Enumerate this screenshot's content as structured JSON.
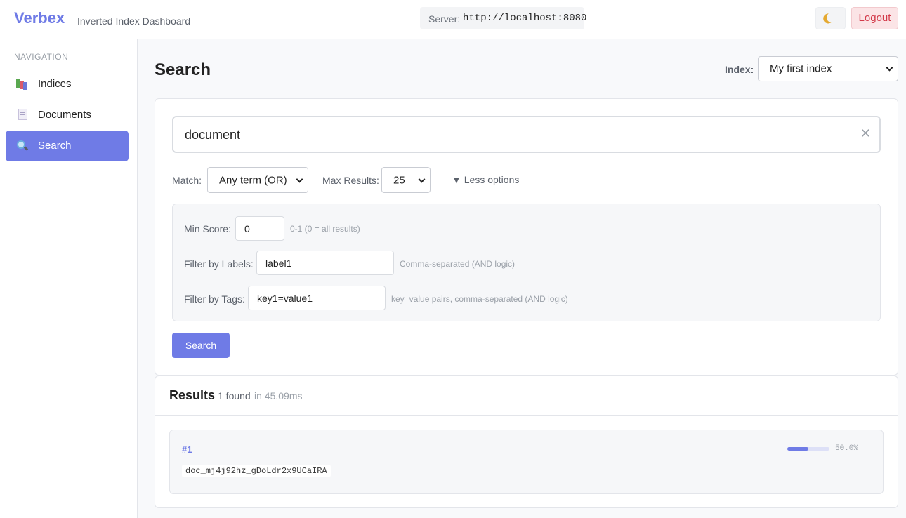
{
  "header": {
    "brand": "Verbex",
    "subtitle": "Inverted Index Dashboard",
    "server_label": "Server:",
    "server_url": "http://localhost:8080",
    "theme_icon": "moon-icon",
    "logout_label": "Logout"
  },
  "sidebar": {
    "heading": "NAVIGATION",
    "items": [
      {
        "label": "Indices",
        "icon": "indices-icon",
        "active": false
      },
      {
        "label": "Documents",
        "icon": "document-icon",
        "active": false
      },
      {
        "label": "Search",
        "icon": "search-icon",
        "active": true
      }
    ]
  },
  "main": {
    "title": "Search",
    "index_label": "Index:",
    "index_selected": "My first index",
    "query": "document",
    "match_label": "Match:",
    "match_selected": "Any term (OR)",
    "max_results_label": "Max Results:",
    "max_results_selected": "25",
    "options_toggle": "▼ Less options",
    "advanced": {
      "min_score_label": "Min Score:",
      "min_score_value": "0",
      "min_score_hint": "0-1 (0 = all results)",
      "labels_label": "Filter by Labels:",
      "labels_value": "label1",
      "labels_hint": "Comma-separated (AND logic)",
      "tags_label": "Filter by Tags:",
      "tags_value": "key1=value1",
      "tags_hint": "key=value pairs, comma-separated (AND logic)"
    },
    "search_button": "Search",
    "results": {
      "title": "Results",
      "count": "1 found",
      "time": "in 45.09ms",
      "items": [
        {
          "rank": "#1",
          "doc_id": "doc_mj4j92hz_gDoLdr2x9UCaIRA",
          "score": 0.5,
          "score_text": "50.0%"
        }
      ]
    }
  },
  "colors": {
    "accent": "#6f7be6",
    "logout": "#d33a4a"
  }
}
